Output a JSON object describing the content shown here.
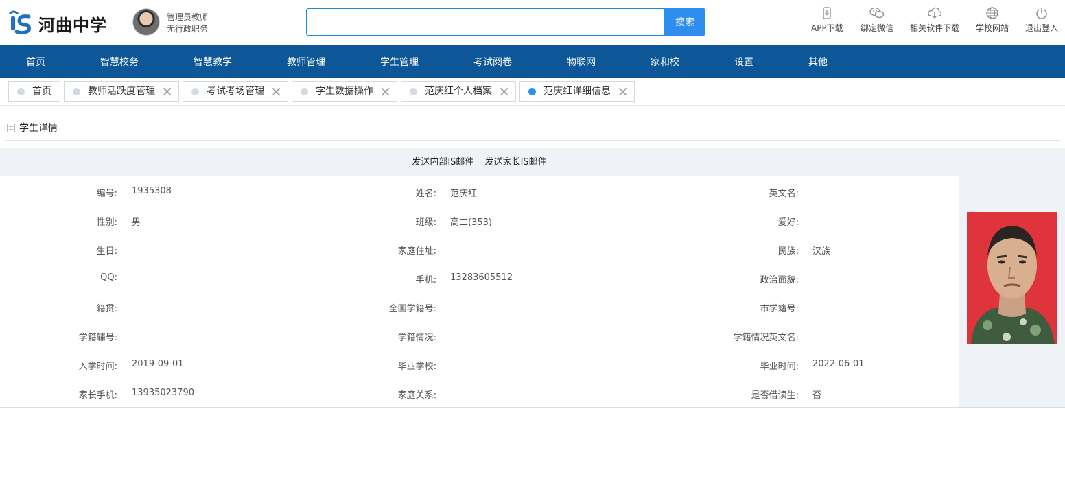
{
  "header": {
    "school_name": "河曲中学",
    "user_role": "管理员教师",
    "user_job": "无行政职务",
    "search_placeholder": "",
    "search_button": "搜索",
    "tools": [
      {
        "label": "APP下载",
        "icon": "phone-icon"
      },
      {
        "label": "绑定微信",
        "icon": "wechat-icon"
      },
      {
        "label": "相关软件下载",
        "icon": "cloud-download-icon"
      },
      {
        "label": "学校网站",
        "icon": "globe-icon"
      },
      {
        "label": "退出登入",
        "icon": "power-icon"
      }
    ]
  },
  "nav": [
    "首页",
    "智慧校务",
    "智慧教学",
    "教师管理",
    "学生管理",
    "考试阅卷",
    "物联网",
    "家和校",
    "设置",
    "其他"
  ],
  "tabs": [
    {
      "label": "首页",
      "closable": false,
      "active": false
    },
    {
      "label": "教师活跃度管理",
      "closable": true,
      "active": false
    },
    {
      "label": "考试考场管理",
      "closable": true,
      "active": false
    },
    {
      "label": "学生数据操作",
      "closable": true,
      "active": false
    },
    {
      "label": "范庆红个人档案",
      "closable": true,
      "active": false
    },
    {
      "label": "范庆红详细信息",
      "closable": true,
      "active": true
    }
  ],
  "subtab": "学生详情",
  "actions": [
    "发送内部IS邮件",
    "发送家长IS邮件"
  ],
  "fields": [
    [
      {
        "label": "编号:",
        "value": "1935308"
      },
      {
        "label": "姓名:",
        "value": "范庆红"
      },
      {
        "label": "英文名:",
        "value": ""
      }
    ],
    [
      {
        "label": "性别:",
        "value": "男"
      },
      {
        "label": "班级:",
        "value": "高二(353)"
      },
      {
        "label": "爱好:",
        "value": ""
      }
    ],
    [
      {
        "label": "生日:",
        "value": ""
      },
      {
        "label": "家庭住址:",
        "value": ""
      },
      {
        "label": "民族:",
        "value": "汉族"
      }
    ],
    [
      {
        "label": "QQ:",
        "value": ""
      },
      {
        "label": "手机:",
        "value": "13283605512"
      },
      {
        "label": "政治面貌:",
        "value": ""
      }
    ],
    [
      {
        "label": "籍贯:",
        "value": ""
      },
      {
        "label": "全国学籍号:",
        "value": ""
      },
      {
        "label": "市学籍号:",
        "value": ""
      }
    ],
    [
      {
        "label": "学籍辅号:",
        "value": ""
      },
      {
        "label": "学籍情况:",
        "value": ""
      },
      {
        "label": "学籍情况英文名:",
        "value": ""
      }
    ],
    [
      {
        "label": "入学时间:",
        "value": "2019-09-01"
      },
      {
        "label": "毕业学校:",
        "value": ""
      },
      {
        "label": "毕业时间:",
        "value": "2022-06-01"
      }
    ],
    [
      {
        "label": "家长手机:",
        "value": "13935023790"
      },
      {
        "label": "家庭关系:",
        "value": ""
      },
      {
        "label": "是否借读生:",
        "value": "否"
      }
    ]
  ],
  "colors": {
    "nav_bg": "#0d5698",
    "accent": "#2d8ef0",
    "photo_bg": "#e0343d"
  }
}
